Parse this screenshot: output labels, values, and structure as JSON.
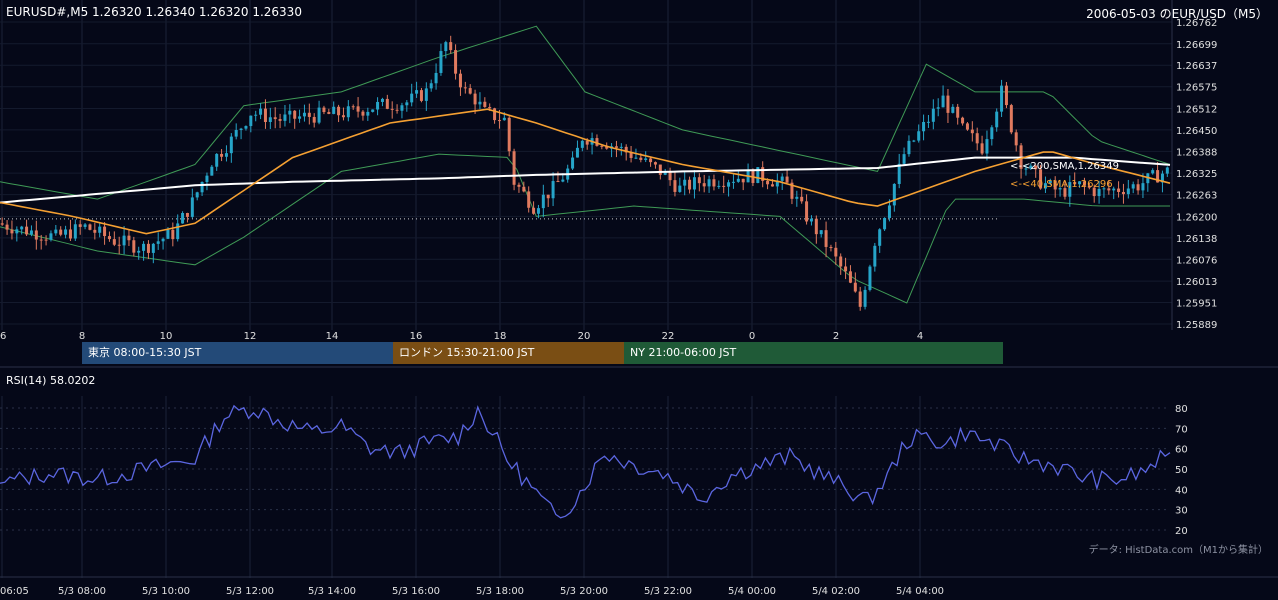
{
  "header": {
    "symbol_line": "EURUSD#,M5 1.26320 1.26340 1.26320 1.26330",
    "title": "2006-05-03 のEUR/USD（M5）"
  },
  "sessions": [
    {
      "label": "東京 08:00-15:30 JST",
      "color": "#234a78"
    },
    {
      "label": "ロンドン 15:30-21:00 JST",
      "color": "#7a4e14"
    },
    {
      "label": "NY 21:00-06:00 JST",
      "color": "#1f5a37"
    }
  ],
  "rsi_label": "RSI(14) 58.0202",
  "source_note": "データ: HistData.com（M1から集計）",
  "colors": {
    "background": "#050818",
    "up": "#26a5c9",
    "down": "#e07a5f",
    "sma200": "#ffffff",
    "sma40": "#f5a032",
    "bollinger": "#3f9a56",
    "rsi": "#5b66e0"
  },
  "chart_data": [
    {
      "type": "candlestick",
      "interval": "M5",
      "ylim": [
        1.25889,
        1.26762
      ],
      "price_ticks": [
        "1.26762",
        "1.26699",
        "1.26637",
        "1.26575",
        "1.26512",
        "1.26450",
        "1.26388",
        "1.26325",
        "1.26263",
        "1.26200",
        "1.26138",
        "1.26076",
        "1.26013",
        "1.25951",
        "1.25889"
      ],
      "hour_ticks": [
        "6",
        "8",
        "10",
        "12",
        "14",
        "16",
        "18",
        "20",
        "22",
        "0",
        "2",
        "4"
      ],
      "reference_level": 1.26193,
      "annotations": [
        {
          "text": "<-<200,SMA,1.26349",
          "value": 1.26349,
          "color": "#ffffff"
        },
        {
          "text": "<-<40,SMA,1.26296",
          "value": 1.26296,
          "color": "#f5a032"
        }
      ],
      "close_path": [
        [
          0,
          1.2618
        ],
        [
          6,
          1.2616
        ],
        [
          12,
          1.2614
        ],
        [
          18,
          1.2617
        ],
        [
          24,
          1.2613
        ],
        [
          30,
          1.2611
        ],
        [
          36,
          1.2615
        ],
        [
          40,
          1.2624
        ],
        [
          44,
          1.2636
        ],
        [
          48,
          1.2642
        ],
        [
          52,
          1.265
        ],
        [
          58,
          1.2648
        ],
        [
          64,
          1.2649
        ],
        [
          72,
          1.265
        ],
        [
          78,
          1.2652
        ],
        [
          84,
          1.2653
        ],
        [
          88,
          1.2656
        ],
        [
          92,
          1.267
        ],
        [
          94,
          1.2662
        ],
        [
          96,
          1.2656
        ],
        [
          98,
          1.2654
        ],
        [
          100,
          1.265
        ],
        [
          104,
          1.2648
        ],
        [
          106,
          1.263
        ],
        [
          110,
          1.2623
        ],
        [
          114,
          1.2628
        ],
        [
          118,
          1.2635
        ],
        [
          120,
          1.2643
        ],
        [
          124,
          1.2642
        ],
        [
          130,
          1.2638
        ],
        [
          136,
          1.2633
        ],
        [
          140,
          1.2628
        ],
        [
          144,
          1.263
        ],
        [
          150,
          1.2631
        ],
        [
          156,
          1.2632
        ],
        [
          162,
          1.2629
        ],
        [
          166,
          1.262
        ],
        [
          170,
          1.2612
        ],
        [
          174,
          1.2603
        ],
        [
          177,
          1.2594
        ],
        [
          180,
          1.2613
        ],
        [
          183,
          1.2625
        ],
        [
          186,
          1.2638
        ],
        [
          190,
          1.2646
        ],
        [
          194,
          1.2654
        ],
        [
          198,
          1.2645
        ],
        [
          202,
          1.264
        ],
        [
          206,
          1.2656
        ],
        [
          210,
          1.2636
        ],
        [
          214,
          1.263
        ],
        [
          218,
          1.2627
        ],
        [
          222,
          1.2629
        ],
        [
          226,
          1.2627
        ],
        [
          230,
          1.2628
        ],
        [
          234,
          1.2629
        ],
        [
          238,
          1.2632
        ],
        [
          240,
          1.2633
        ]
      ],
      "sma200_path": [
        [
          0,
          1.2624
        ],
        [
          40,
          1.2629
        ],
        [
          60,
          1.263
        ],
        [
          90,
          1.2631
        ],
        [
          110,
          1.2632
        ],
        [
          140,
          1.2633
        ],
        [
          180,
          1.2634
        ],
        [
          200,
          1.2637
        ],
        [
          220,
          1.2637
        ],
        [
          240,
          1.26349
        ]
      ],
      "sma40_path": [
        [
          0,
          1.2624
        ],
        [
          15,
          1.262
        ],
        [
          30,
          1.2615
        ],
        [
          40,
          1.2618
        ],
        [
          60,
          1.2637
        ],
        [
          80,
          1.2647
        ],
        [
          100,
          1.2651
        ],
        [
          110,
          1.2647
        ],
        [
          125,
          1.264
        ],
        [
          140,
          1.2635
        ],
        [
          160,
          1.263
        ],
        [
          175,
          1.2624
        ],
        [
          180,
          1.2623
        ],
        [
          200,
          1.2633
        ],
        [
          215,
          1.2639
        ],
        [
          225,
          1.2635
        ],
        [
          240,
          1.26296
        ]
      ],
      "bollinger_upper": [
        [
          0,
          1.263
        ],
        [
          20,
          1.2625
        ],
        [
          40,
          1.2635
        ],
        [
          50,
          1.2652
        ],
        [
          70,
          1.2656
        ],
        [
          90,
          1.2666
        ],
        [
          110,
          1.2675
        ],
        [
          120,
          1.2656
        ],
        [
          140,
          1.2645
        ],
        [
          160,
          1.2639
        ],
        [
          180,
          1.2633
        ],
        [
          190,
          1.2664
        ],
        [
          200,
          1.2656
        ],
        [
          215,
          1.2656
        ],
        [
          225,
          1.2642
        ],
        [
          240,
          1.2635
        ]
      ],
      "bollinger_lower": [
        [
          0,
          1.2617
        ],
        [
          20,
          1.261
        ],
        [
          40,
          1.2606
        ],
        [
          50,
          1.2614
        ],
        [
          70,
          1.2633
        ],
        [
          90,
          1.2638
        ],
        [
          105,
          1.2637
        ],
        [
          110,
          1.262
        ],
        [
          130,
          1.2623
        ],
        [
          160,
          1.262
        ],
        [
          175,
          1.2602
        ],
        [
          186,
          1.2595
        ],
        [
          195,
          1.2625
        ],
        [
          210,
          1.2625
        ],
        [
          225,
          1.2623
        ],
        [
          240,
          1.2623
        ]
      ]
    },
    {
      "type": "line",
      "title": "RSI(14)",
      "ylim": [
        20,
        80
      ],
      "y_ticks": [
        80,
        70,
        60,
        50,
        40,
        30,
        20
      ],
      "x_ticks": [
        "06:05",
        "5/3 08:00",
        "5/3 10:00",
        "5/3 12:00",
        "5/3 14:00",
        "5/3 16:00",
        "5/3 18:00",
        "5/3 20:00",
        "5/3 22:00",
        "5/4 00:00",
        "5/4 02:00",
        "5/4 04:00"
      ],
      "last_value": 58.0202,
      "rsi_path": [
        [
          0,
          43
        ],
        [
          10,
          48
        ],
        [
          20,
          45
        ],
        [
          30,
          50
        ],
        [
          40,
          55
        ],
        [
          46,
          76
        ],
        [
          52,
          80
        ],
        [
          58,
          73
        ],
        [
          64,
          68
        ],
        [
          70,
          71
        ],
        [
          76,
          60
        ],
        [
          82,
          58
        ],
        [
          88,
          63
        ],
        [
          94,
          66
        ],
        [
          98,
          79
        ],
        [
          100,
          72
        ],
        [
          104,
          55
        ],
        [
          110,
          38
        ],
        [
          114,
          26
        ],
        [
          118,
          35
        ],
        [
          124,
          58
        ],
        [
          130,
          52
        ],
        [
          136,
          48
        ],
        [
          144,
          36
        ],
        [
          150,
          47
        ],
        [
          156,
          52
        ],
        [
          162,
          56
        ],
        [
          168,
          48
        ],
        [
          174,
          40
        ],
        [
          178,
          34
        ],
        [
          182,
          46
        ],
        [
          186,
          64
        ],
        [
          190,
          66
        ],
        [
          194,
          62
        ],
        [
          198,
          68
        ],
        [
          204,
          62
        ],
        [
          210,
          55
        ],
        [
          216,
          52
        ],
        [
          222,
          46
        ],
        [
          228,
          44
        ],
        [
          234,
          48
        ],
        [
          240,
          58
        ]
      ]
    }
  ]
}
